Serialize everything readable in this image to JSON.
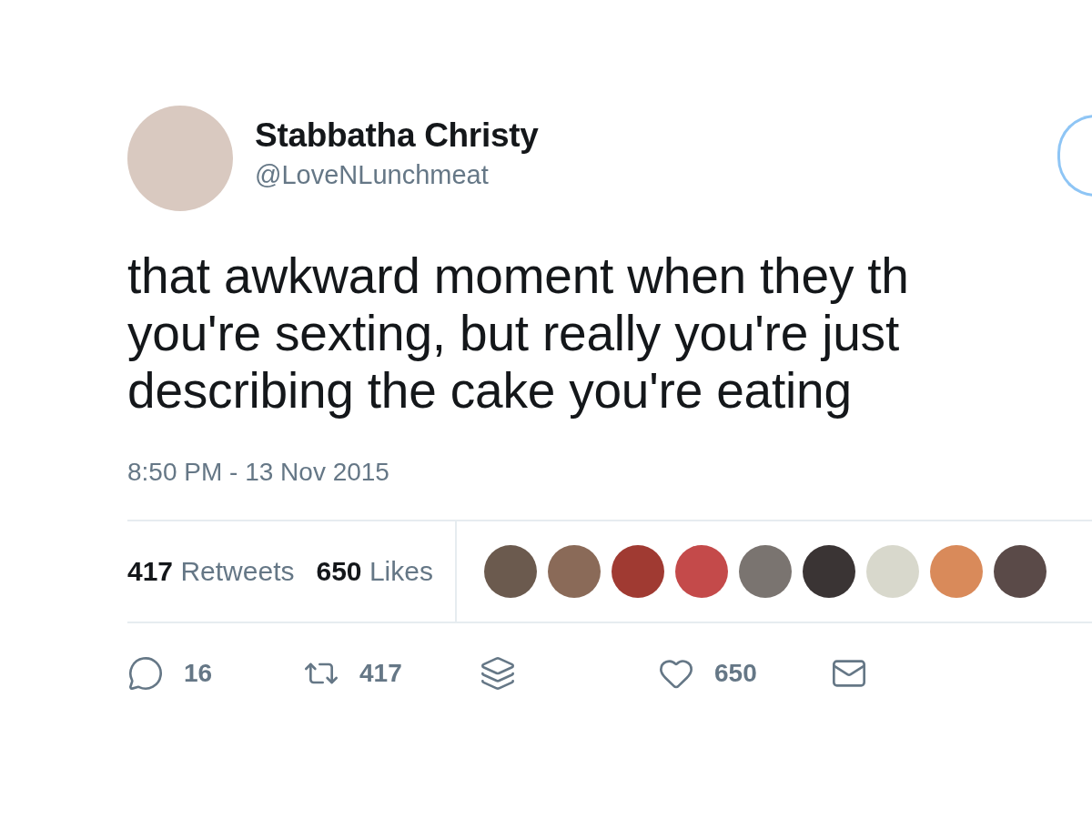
{
  "author": {
    "name": "Stabbatha Christy",
    "handle": "@LoveNLunchmeat"
  },
  "tweet_lines": [
    "that awkward moment when they th",
    "you're sexting, but really you're just",
    "describing the cake you're eating"
  ],
  "timestamp": "8:50 PM - 13 Nov 2015",
  "stats": [
    {
      "count": "417",
      "label": "Retweets"
    },
    {
      "count": "650",
      "label": "Likes"
    }
  ],
  "actions": [
    {
      "kind": "reply",
      "count": "16"
    },
    {
      "kind": "retweet",
      "count": "417"
    },
    {
      "kind": "stack"
    },
    {
      "kind": "like",
      "count": "650"
    },
    {
      "kind": "message"
    }
  ]
}
